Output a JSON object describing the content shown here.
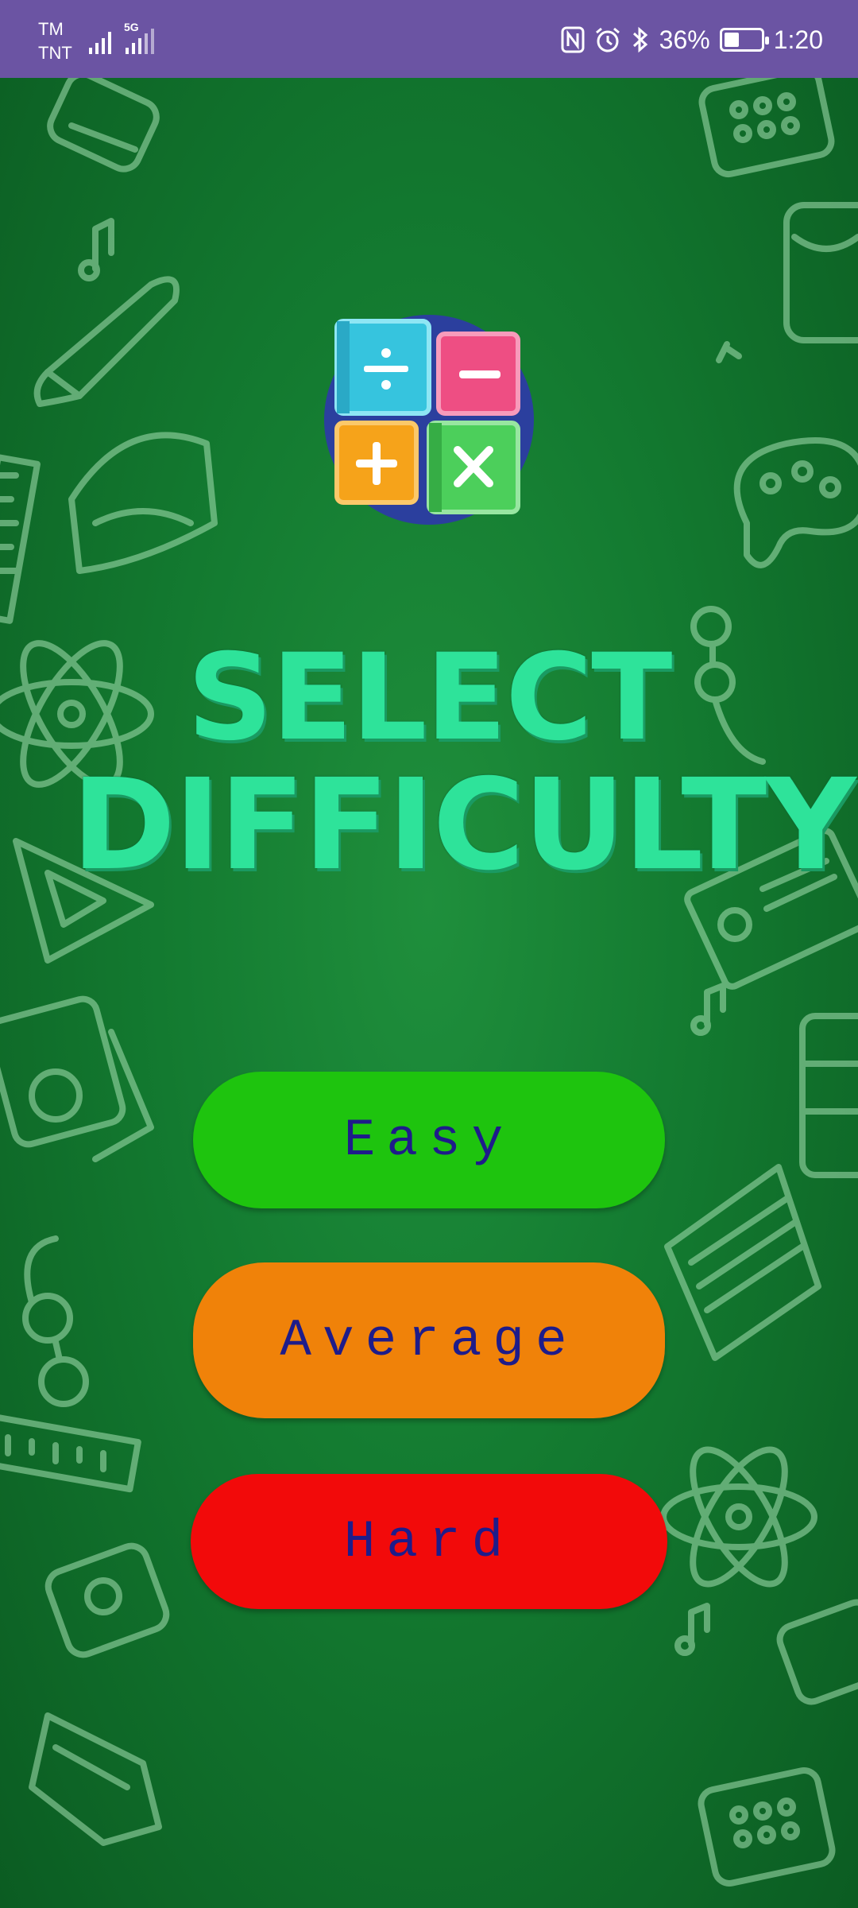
{
  "status_bar": {
    "carrier_1": "TM",
    "carrier_2": "TNT",
    "network_type": "5G",
    "battery_text": "36%",
    "battery_level": 0.36,
    "time": "1:20",
    "icons": [
      "signal-icon",
      "nfc-icon",
      "alarm-icon",
      "bluetooth-icon",
      "battery-charging-icon"
    ]
  },
  "screen": {
    "title_line_1": "SELECT",
    "title_line_2": "DIFFICULTY",
    "logo": "math-operations-logo"
  },
  "buttons": [
    {
      "id": "easy",
      "label": "Easy",
      "color": "#1ec40e"
    },
    {
      "id": "average",
      "label": "Average",
      "color": "#f08209"
    },
    {
      "id": "hard",
      "label": "Hard",
      "color": "#f20a0a"
    }
  ],
  "colors": {
    "status_bar": "#6b54a3",
    "background": "#137a30",
    "title": "#2ee39a",
    "button_text": "#1e1c8a"
  }
}
